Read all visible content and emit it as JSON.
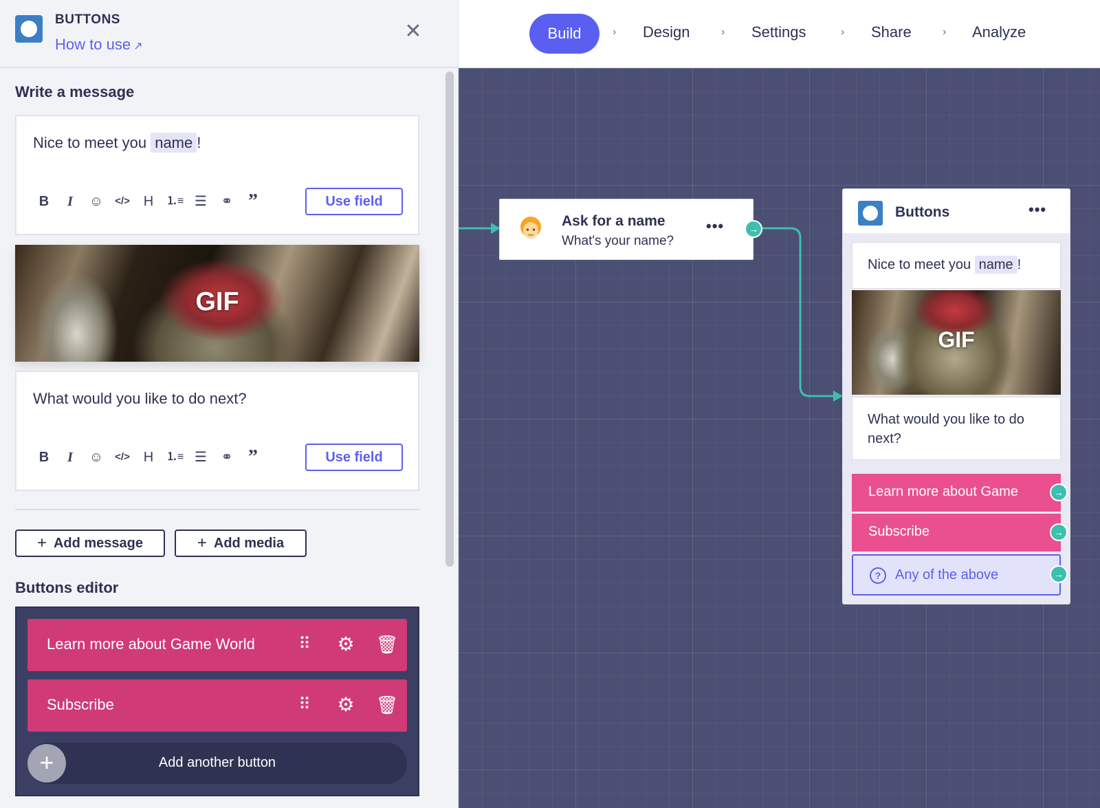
{
  "panel": {
    "title": "BUTTONS",
    "how_to_use": "How to use",
    "write_message_title": "Write a message",
    "message1": {
      "prefix": "Nice to meet you",
      "field": "name",
      "suffix": "!"
    },
    "use_field_label": "Use field",
    "gif_label": "GIF",
    "message2": "What would you like to do next?",
    "toolbar_icons": [
      "bold-icon",
      "italic-icon",
      "emoji-icon",
      "code-icon",
      "heading-icon",
      "ordered-list-icon",
      "bullet-list-icon",
      "link-icon",
      "quote-icon"
    ],
    "add_message_label": "Add message",
    "add_media_label": "Add media",
    "buttons_editor_title": "Buttons editor",
    "editor_buttons": [
      {
        "label": "Learn more about Game World"
      },
      {
        "label": "Subscribe"
      }
    ],
    "add_another_label": "Add another button"
  },
  "nav": {
    "steps": [
      "Build",
      "Design",
      "Settings",
      "Share",
      "Analyze"
    ],
    "active": "Build"
  },
  "canvas": {
    "ask_node": {
      "title": "Ask for a name",
      "subtitle": "What's your name?"
    },
    "buttons_node": {
      "title": "Buttons",
      "message1": {
        "prefix": "Nice to meet you",
        "field": "name",
        "suffix": "!"
      },
      "gif_label": "GIF",
      "message2": "What would you like to do next?",
      "buttons": [
        "Learn more about Game",
        "Subscribe"
      ],
      "fallback": "Any of the above"
    }
  },
  "colors": {
    "accent": "#5b5ff0",
    "button_pink": "#ea4f8f",
    "editor_pink": "#d03a77",
    "connector": "#3dbfb0",
    "canvas_bg": "#4a4f73"
  }
}
